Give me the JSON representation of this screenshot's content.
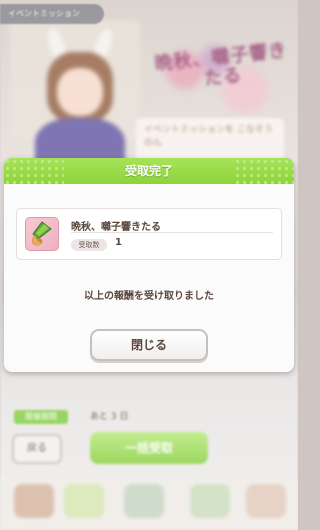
{
  "background": {
    "top_label": "イベントミッション",
    "logo_text": "晩秋、囃子響きたる",
    "speech_text": "イベントミッションを こなそうのん",
    "period_tag": "開催期間",
    "remaining": "あと 3 日",
    "back_label": "戻る",
    "bulk_label": "一括受取"
  },
  "dialog": {
    "title": "受取完了",
    "reward": {
      "icon": "horseshoe-badge-icon",
      "name": "晩秋、囃子響きたる",
      "qty_label": "受取数",
      "qty_value": "1"
    },
    "message": "以上の報酬を受け取りました",
    "close_label": "閉じる"
  },
  "colors": {
    "header_green": "#8dd43a",
    "text_brown": "#5b463c",
    "icon_pink": "#f6c8d2"
  }
}
